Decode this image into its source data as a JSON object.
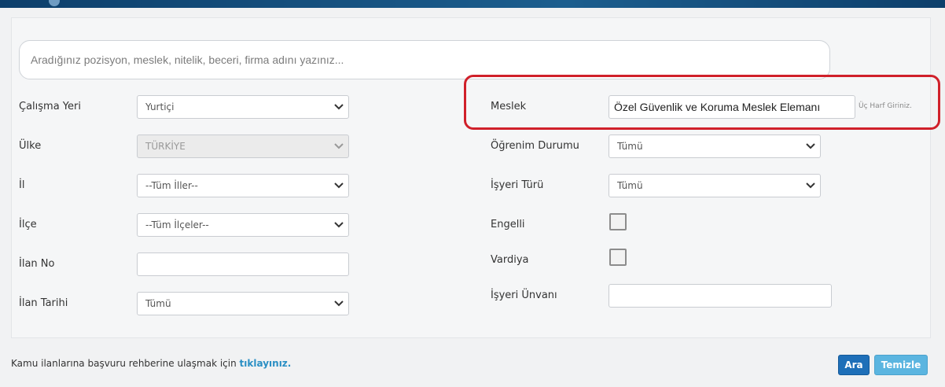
{
  "search": {
    "placeholder": "Aradığınız pozisyon, meslek, nitelik, beceri, firma adını yazınız..."
  },
  "left_fields": {
    "calisma_yeri": {
      "label": "Çalışma Yeri",
      "value": "Yurtiçi"
    },
    "ulke": {
      "label": "Ülke",
      "value": "TÜRKİYE"
    },
    "il": {
      "label": "İl",
      "value": "--Tüm İller--"
    },
    "ilce": {
      "label": "İlçe",
      "value": "--Tüm İlçeler--"
    },
    "ilan_no": {
      "label": "İlan No",
      "value": ""
    },
    "ilan_tarihi": {
      "label": "İlan Tarihi",
      "value": "Tümü"
    }
  },
  "right_fields": {
    "meslek": {
      "label": "Meslek",
      "value": "Özel Güvenlik ve Koruma Meslek Elemanı",
      "hint": "Üç Harf Giriniz."
    },
    "ogrenim_durumu": {
      "label": "Öğrenim Durumu",
      "value": "Tümü"
    },
    "isyeri_turu": {
      "label": "İşyeri Türü",
      "value": "Tümü"
    },
    "engelli": {
      "label": "Engelli"
    },
    "vardiya": {
      "label": "Vardiya"
    },
    "isyeri_unvani": {
      "label": "İşyeri Ünvanı",
      "value": ""
    }
  },
  "footer": {
    "text": "Kamu ilanlarına başvuru rehberine ulaşmak için",
    "link": "tıklayınız."
  },
  "buttons": {
    "search": "Ara",
    "clear": "Temizle"
  },
  "colors": {
    "highlight": "#d0202a",
    "primary_button": "#1e6fb8",
    "secondary_button": "#5bb5e0",
    "link": "#2a8fc4"
  }
}
